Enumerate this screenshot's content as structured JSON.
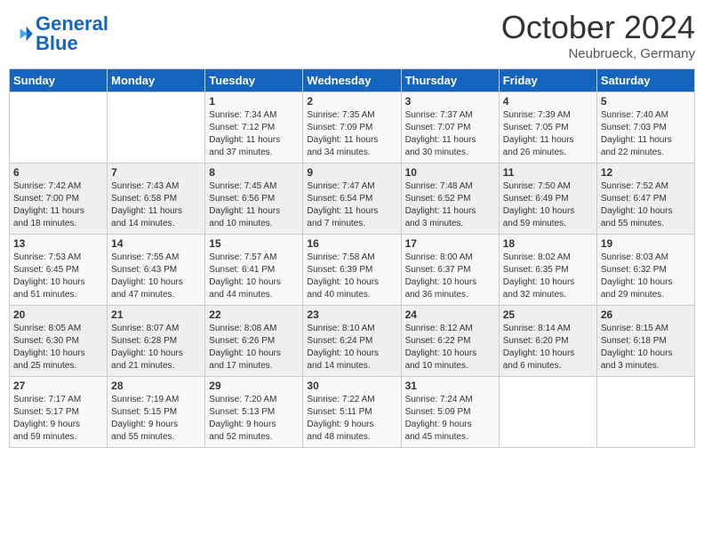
{
  "header": {
    "logo_line1": "General",
    "logo_line2": "Blue",
    "month": "October 2024",
    "location": "Neubrueck, Germany"
  },
  "weekdays": [
    "Sunday",
    "Monday",
    "Tuesday",
    "Wednesday",
    "Thursday",
    "Friday",
    "Saturday"
  ],
  "weeks": [
    [
      {
        "day": "",
        "info": ""
      },
      {
        "day": "",
        "info": ""
      },
      {
        "day": "1",
        "info": "Sunrise: 7:34 AM\nSunset: 7:12 PM\nDaylight: 11 hours\nand 37 minutes."
      },
      {
        "day": "2",
        "info": "Sunrise: 7:35 AM\nSunset: 7:09 PM\nDaylight: 11 hours\nand 34 minutes."
      },
      {
        "day": "3",
        "info": "Sunrise: 7:37 AM\nSunset: 7:07 PM\nDaylight: 11 hours\nand 30 minutes."
      },
      {
        "day": "4",
        "info": "Sunrise: 7:39 AM\nSunset: 7:05 PM\nDaylight: 11 hours\nand 26 minutes."
      },
      {
        "day": "5",
        "info": "Sunrise: 7:40 AM\nSunset: 7:03 PM\nDaylight: 11 hours\nand 22 minutes."
      }
    ],
    [
      {
        "day": "6",
        "info": "Sunrise: 7:42 AM\nSunset: 7:00 PM\nDaylight: 11 hours\nand 18 minutes."
      },
      {
        "day": "7",
        "info": "Sunrise: 7:43 AM\nSunset: 6:58 PM\nDaylight: 11 hours\nand 14 minutes."
      },
      {
        "day": "8",
        "info": "Sunrise: 7:45 AM\nSunset: 6:56 PM\nDaylight: 11 hours\nand 10 minutes."
      },
      {
        "day": "9",
        "info": "Sunrise: 7:47 AM\nSunset: 6:54 PM\nDaylight: 11 hours\nand 7 minutes."
      },
      {
        "day": "10",
        "info": "Sunrise: 7:48 AM\nSunset: 6:52 PM\nDaylight: 11 hours\nand 3 minutes."
      },
      {
        "day": "11",
        "info": "Sunrise: 7:50 AM\nSunset: 6:49 PM\nDaylight: 10 hours\nand 59 minutes."
      },
      {
        "day": "12",
        "info": "Sunrise: 7:52 AM\nSunset: 6:47 PM\nDaylight: 10 hours\nand 55 minutes."
      }
    ],
    [
      {
        "day": "13",
        "info": "Sunrise: 7:53 AM\nSunset: 6:45 PM\nDaylight: 10 hours\nand 51 minutes."
      },
      {
        "day": "14",
        "info": "Sunrise: 7:55 AM\nSunset: 6:43 PM\nDaylight: 10 hours\nand 47 minutes."
      },
      {
        "day": "15",
        "info": "Sunrise: 7:57 AM\nSunset: 6:41 PM\nDaylight: 10 hours\nand 44 minutes."
      },
      {
        "day": "16",
        "info": "Sunrise: 7:58 AM\nSunset: 6:39 PM\nDaylight: 10 hours\nand 40 minutes."
      },
      {
        "day": "17",
        "info": "Sunrise: 8:00 AM\nSunset: 6:37 PM\nDaylight: 10 hours\nand 36 minutes."
      },
      {
        "day": "18",
        "info": "Sunrise: 8:02 AM\nSunset: 6:35 PM\nDaylight: 10 hours\nand 32 minutes."
      },
      {
        "day": "19",
        "info": "Sunrise: 8:03 AM\nSunset: 6:32 PM\nDaylight: 10 hours\nand 29 minutes."
      }
    ],
    [
      {
        "day": "20",
        "info": "Sunrise: 8:05 AM\nSunset: 6:30 PM\nDaylight: 10 hours\nand 25 minutes."
      },
      {
        "day": "21",
        "info": "Sunrise: 8:07 AM\nSunset: 6:28 PM\nDaylight: 10 hours\nand 21 minutes."
      },
      {
        "day": "22",
        "info": "Sunrise: 8:08 AM\nSunset: 6:26 PM\nDaylight: 10 hours\nand 17 minutes."
      },
      {
        "day": "23",
        "info": "Sunrise: 8:10 AM\nSunset: 6:24 PM\nDaylight: 10 hours\nand 14 minutes."
      },
      {
        "day": "24",
        "info": "Sunrise: 8:12 AM\nSunset: 6:22 PM\nDaylight: 10 hours\nand 10 minutes."
      },
      {
        "day": "25",
        "info": "Sunrise: 8:14 AM\nSunset: 6:20 PM\nDaylight: 10 hours\nand 6 minutes."
      },
      {
        "day": "26",
        "info": "Sunrise: 8:15 AM\nSunset: 6:18 PM\nDaylight: 10 hours\nand 3 minutes."
      }
    ],
    [
      {
        "day": "27",
        "info": "Sunrise: 7:17 AM\nSunset: 5:17 PM\nDaylight: 9 hours\nand 59 minutes."
      },
      {
        "day": "28",
        "info": "Sunrise: 7:19 AM\nSunset: 5:15 PM\nDaylight: 9 hours\nand 55 minutes."
      },
      {
        "day": "29",
        "info": "Sunrise: 7:20 AM\nSunset: 5:13 PM\nDaylight: 9 hours\nand 52 minutes."
      },
      {
        "day": "30",
        "info": "Sunrise: 7:22 AM\nSunset: 5:11 PM\nDaylight: 9 hours\nand 48 minutes."
      },
      {
        "day": "31",
        "info": "Sunrise: 7:24 AM\nSunset: 5:09 PM\nDaylight: 9 hours\nand 45 minutes."
      },
      {
        "day": "",
        "info": ""
      },
      {
        "day": "",
        "info": ""
      }
    ]
  ]
}
